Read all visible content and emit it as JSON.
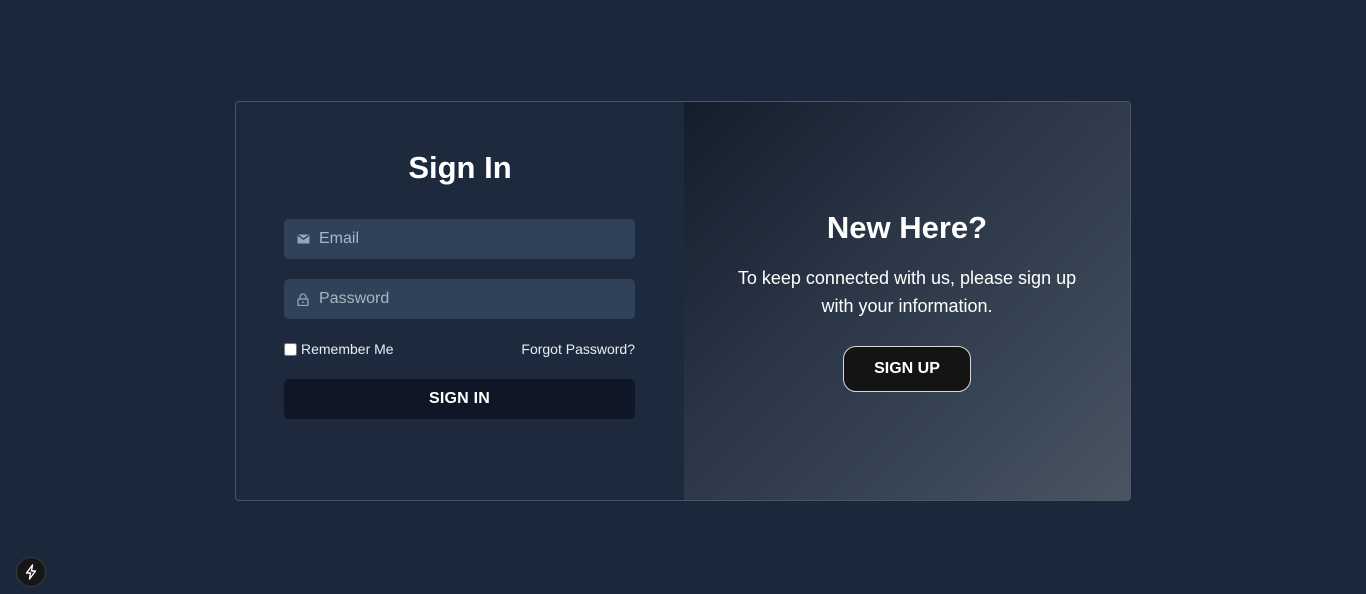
{
  "signin": {
    "title": "Sign In",
    "email_placeholder": "Email",
    "password_placeholder": "Password",
    "remember_label": "Remember Me",
    "forgot_label": "Forgot Password?",
    "button_label": "SIGN IN"
  },
  "signup_panel": {
    "title": "New Here?",
    "text": "To keep connected with us, please sign up with your information.",
    "button_label": "SIGN UP"
  },
  "icons": {
    "email": "mail-icon",
    "password": "lock-icon",
    "badge": "lightning-bolt-icon"
  },
  "colors": {
    "background": "#1b283b",
    "left_panel": "#1d2a3e",
    "input_bg": "#2f4259",
    "signin_button": "#0f1726",
    "signup_button": "#141414"
  }
}
